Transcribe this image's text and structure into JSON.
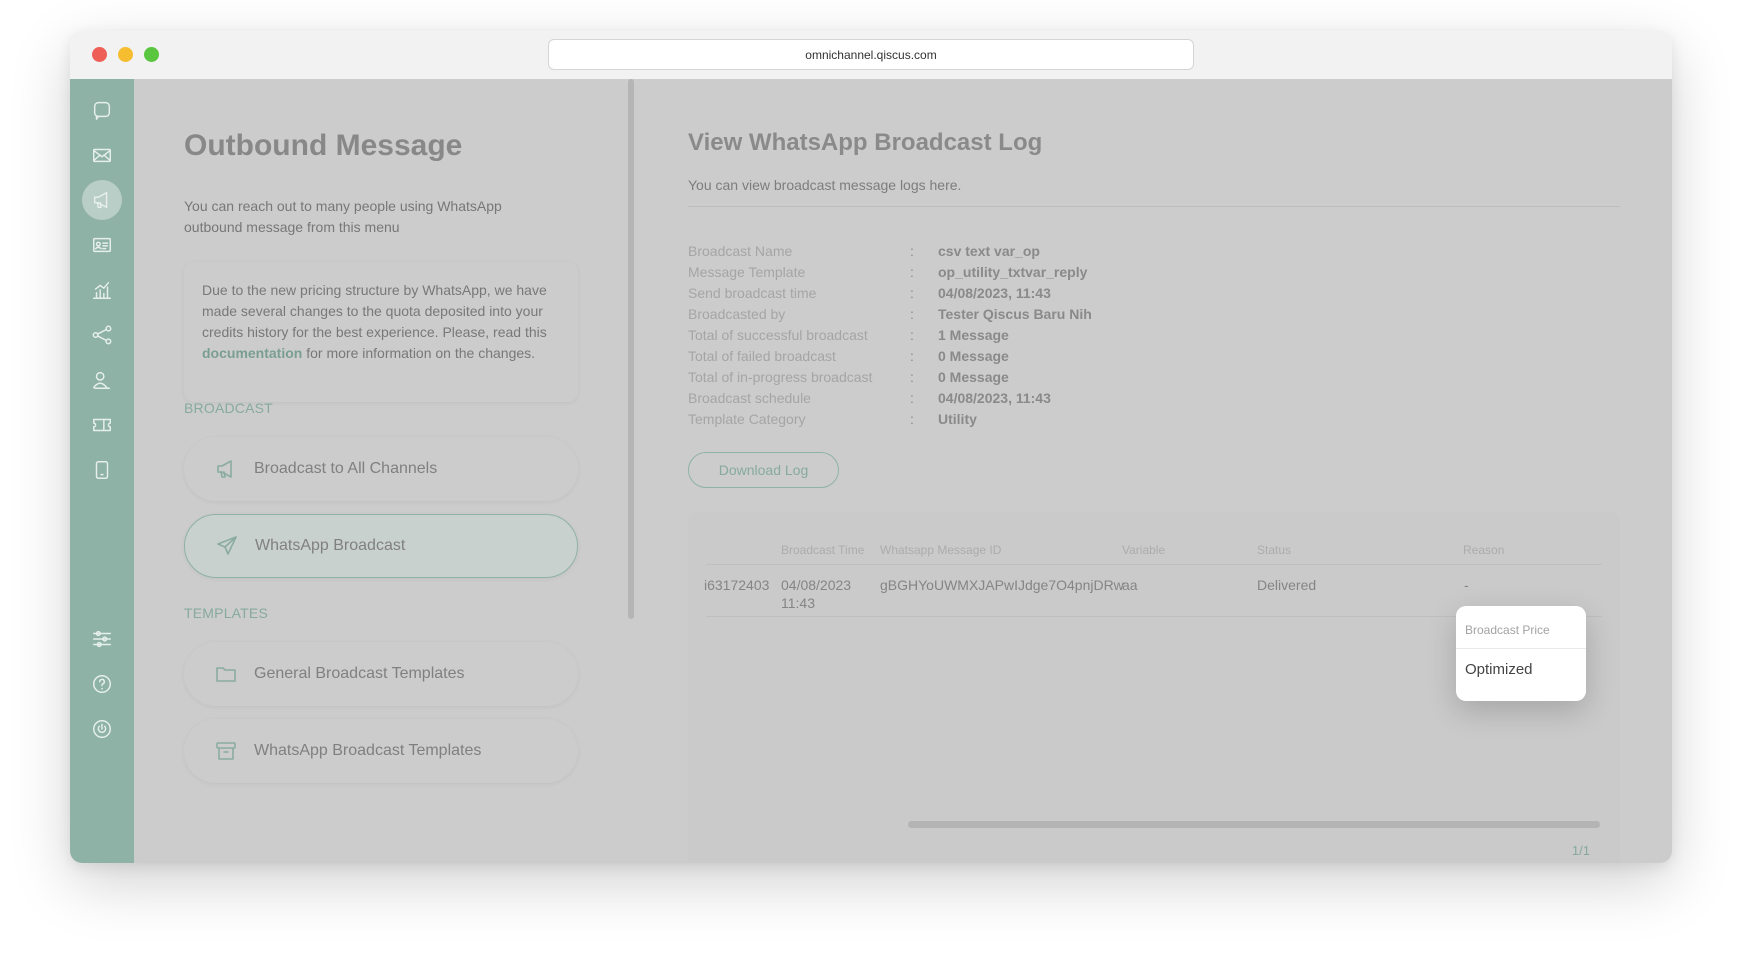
{
  "browser": {
    "url": "omnichannel.qiscus.com"
  },
  "iconbar": {
    "items": [
      {
        "name": "chat-icon"
      },
      {
        "name": "mail-icon"
      },
      {
        "name": "megaphone-icon",
        "active": true
      },
      {
        "name": "contact-card-icon"
      },
      {
        "name": "analytics-icon"
      },
      {
        "name": "integration-icon"
      },
      {
        "name": "agent-icon"
      },
      {
        "name": "ticket-icon"
      },
      {
        "name": "mobile-icon"
      }
    ],
    "bottom_items": [
      {
        "name": "settings-sliders-icon"
      },
      {
        "name": "help-icon"
      },
      {
        "name": "power-icon"
      }
    ]
  },
  "left_panel": {
    "title": "Outbound Message",
    "description": "You can reach out to many people using WhatsApp outbound message from this menu",
    "notice": {
      "text_before": "Due to the new pricing structure by WhatsApp, we have made several changes to the quota deposited into your credits history for the best experience. Please, read this ",
      "link_text": "documentation",
      "text_after": " for more information on the changes."
    },
    "broadcast_section": {
      "label": "BROADCAST",
      "items": [
        {
          "label": "Broadcast to All Channels",
          "icon": "megaphone-icon"
        },
        {
          "label": "WhatsApp Broadcast",
          "icon": "send-icon",
          "active": true
        }
      ]
    },
    "templates_section": {
      "label": "TEMPLATES",
      "items": [
        {
          "label": "General Broadcast Templates",
          "icon": "folder-icon"
        },
        {
          "label": "WhatsApp Broadcast Templates",
          "icon": "archive-icon"
        }
      ]
    }
  },
  "right_panel": {
    "title": "View WhatsApp Broadcast Log",
    "description": "You can view broadcast message logs here.",
    "info": [
      {
        "label": "Broadcast Name",
        "value": "csv text var_op"
      },
      {
        "label": "Message Template",
        "value": "op_utility_txtvar_reply"
      },
      {
        "label": "Send broadcast time",
        "value": "04/08/2023, 11:43"
      },
      {
        "label": "Broadcasted by",
        "value": "Tester Qiscus Baru Nih"
      },
      {
        "label": "Total of successful broadcast",
        "value": "1 Message"
      },
      {
        "label": "Total of failed broadcast",
        "value": "0 Message"
      },
      {
        "label": "Total of in-progress broadcast",
        "value": "0 Message"
      },
      {
        "label": "Broadcast schedule",
        "value": "04/08/2023, 11:43"
      },
      {
        "label": "Template Category",
        "value": "Utility"
      }
    ],
    "info_colon": ":",
    "download_button": "Download Log",
    "table": {
      "headers": {
        "broadcast_time": "Broadcast Time",
        "message_id": "Whatsapp Message ID",
        "variable": "Variable",
        "status": "Status",
        "broadcast_price": "Broadcast Price",
        "reason": "Reason"
      },
      "row": {
        "phone": "i63172403",
        "time_date": "04/08/2023",
        "time_clock": "11:43",
        "message_id": "gBGHYoUWMXJAPwIJdge7O4pnjDRw",
        "variable": "aa",
        "status": "Delivered",
        "reason": "-"
      },
      "pagination": "1/1"
    },
    "price_popover": {
      "header": "Broadcast Price",
      "value": "Optimized"
    }
  }
}
